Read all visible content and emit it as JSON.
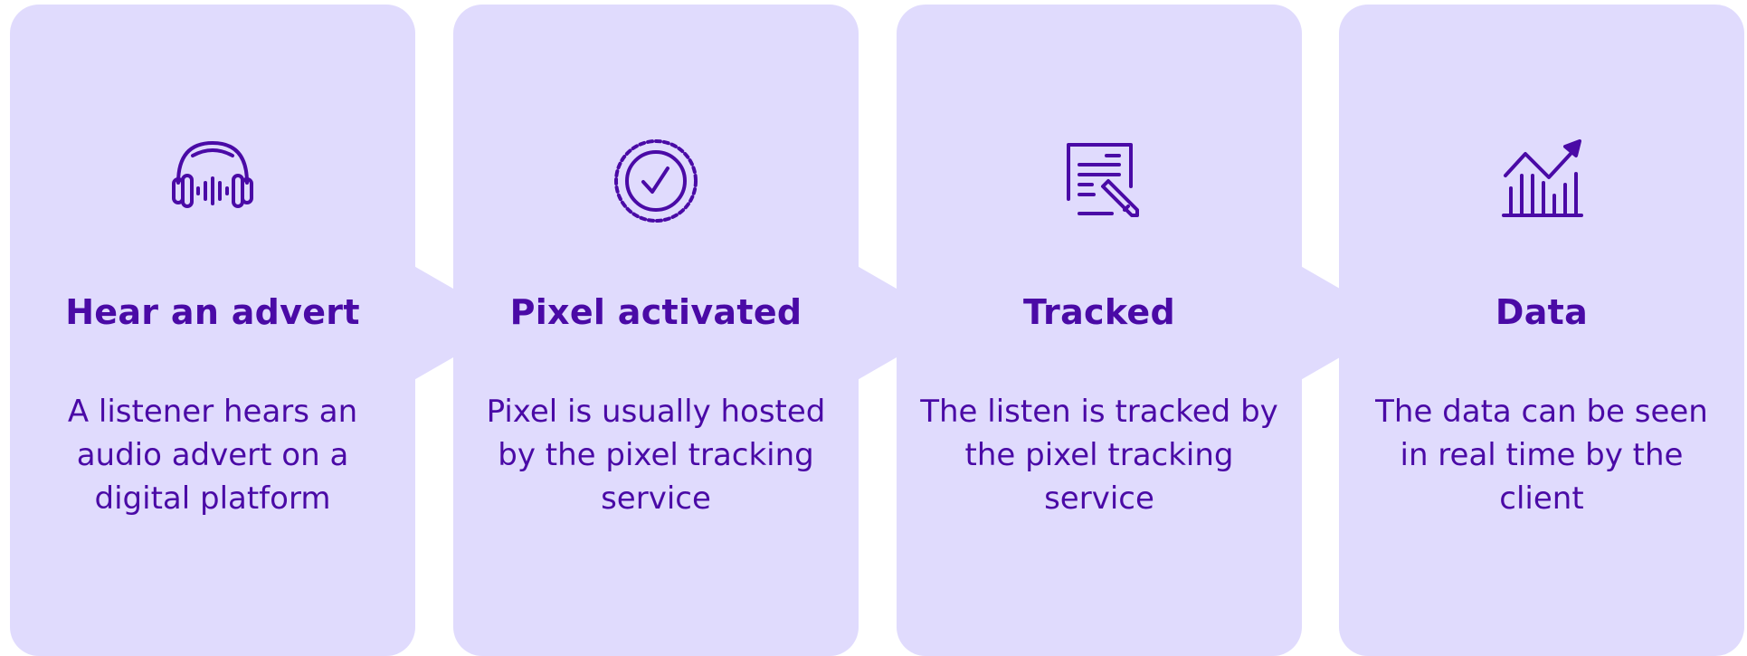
{
  "colors": {
    "card": "#e0dbfd",
    "accent": "#4a0aa6",
    "background": "#ffffff"
  },
  "steps": [
    {
      "icon": "headphones-icon",
      "title": "Hear an advert",
      "description": "A listener hears an audio advert on a digital platform"
    },
    {
      "icon": "verified-badge-icon",
      "title": "Pixel activated",
      "description": "Pixel is usually hosted by the pixel tracking service"
    },
    {
      "icon": "document-edit-icon",
      "title": "Tracked",
      "description": "The listen is tracked by the pixel tracking service"
    },
    {
      "icon": "growth-chart-icon",
      "title": "Data",
      "description": "The data can be seen in real time by the client"
    }
  ]
}
